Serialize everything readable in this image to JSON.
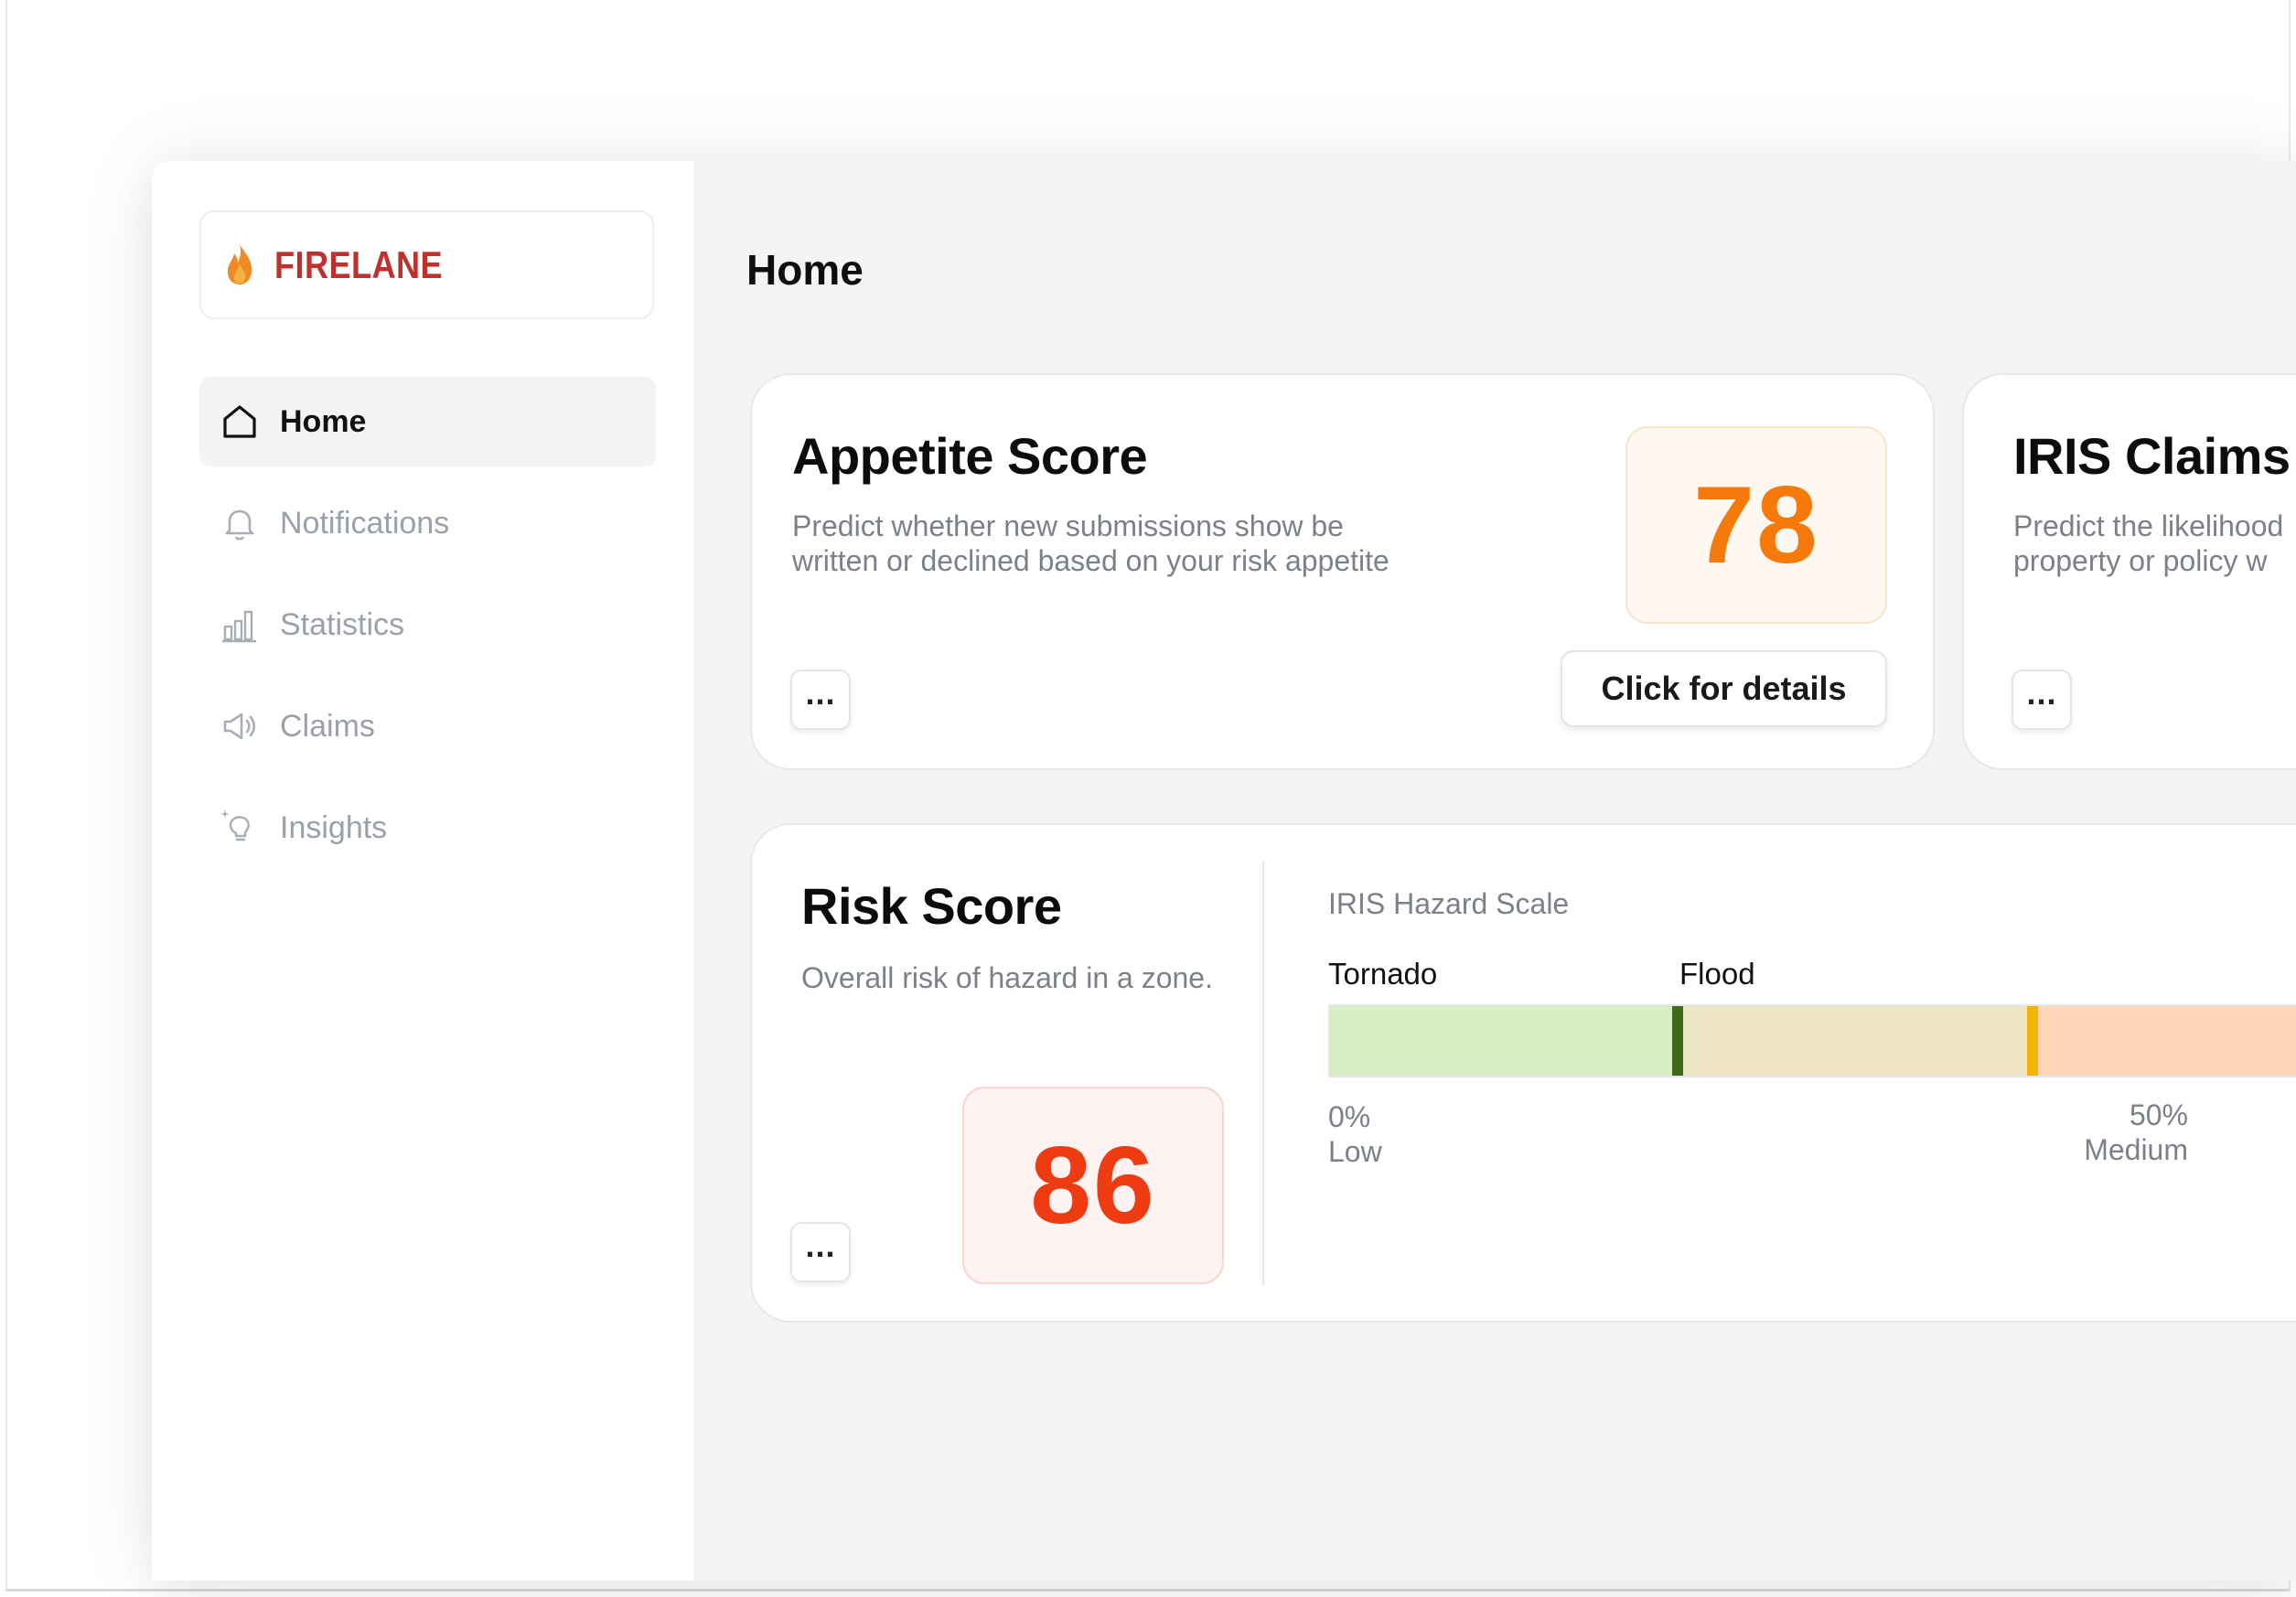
{
  "brand": {
    "name": "FIRELANE"
  },
  "nav": {
    "items": [
      {
        "label": "Home",
        "icon": "home-icon",
        "active": true
      },
      {
        "label": "Notifications",
        "icon": "bell-icon",
        "active": false
      },
      {
        "label": "Statistics",
        "icon": "bar-chart-icon",
        "active": false
      },
      {
        "label": "Claims",
        "icon": "megaphone-icon",
        "active": false
      },
      {
        "label": "Insights",
        "icon": "lightbulb-icon",
        "active": false
      }
    ]
  },
  "page": {
    "title": "Home"
  },
  "appetite_card": {
    "title": "Appetite Score",
    "description_line1": "Predict whether new submissions show be",
    "description_line2": "written or declined based on your risk appetite",
    "score": "78",
    "details_label": "Click for details",
    "more_label": "..."
  },
  "iris_card": {
    "title": "IRIS Claims",
    "description_line1": "Predict the likelihood",
    "description_line2": "property or policy w",
    "more_label": "..."
  },
  "risk_card": {
    "title": "Risk Score",
    "description": "Overall risk of hazard in a zone.",
    "score": "86",
    "more_label": "...",
    "scale": {
      "title": "IRIS Hazard Scale",
      "markers": [
        {
          "label": "Tornado",
          "position": 0.0
        },
        {
          "label": "Flood",
          "position": 0.18
        },
        {
          "position": 0.36
        }
      ],
      "ticks": [
        {
          "percent": "0%",
          "level": "Low"
        },
        {
          "percent": "50%",
          "level": "Medium"
        }
      ]
    }
  },
  "colors": {
    "brand_red": "#c0302c",
    "flame_orange": "#f08a24",
    "appetite_score": "#f57a0b",
    "risk_score": "#ef3b12",
    "scale_low": "#d6efc2",
    "scale_mid": "#eee5c4",
    "scale_high": "#ffd7b8",
    "marker_green": "#3f6a1b",
    "marker_yellow": "#f5b400"
  }
}
